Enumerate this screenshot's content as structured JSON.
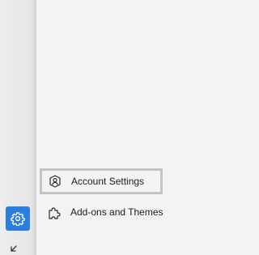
{
  "menu": {
    "items": [
      {
        "label": "Account Settings",
        "icon": "account-icon",
        "focused": true
      },
      {
        "label": "Add-ons and Themes",
        "icon": "puzzle-icon",
        "focused": false
      }
    ]
  },
  "sidebar": {
    "settings_icon": "gear-icon",
    "settings_button_color": "#2a7de1",
    "collapse_icon": "collapse-arrow-icon"
  }
}
